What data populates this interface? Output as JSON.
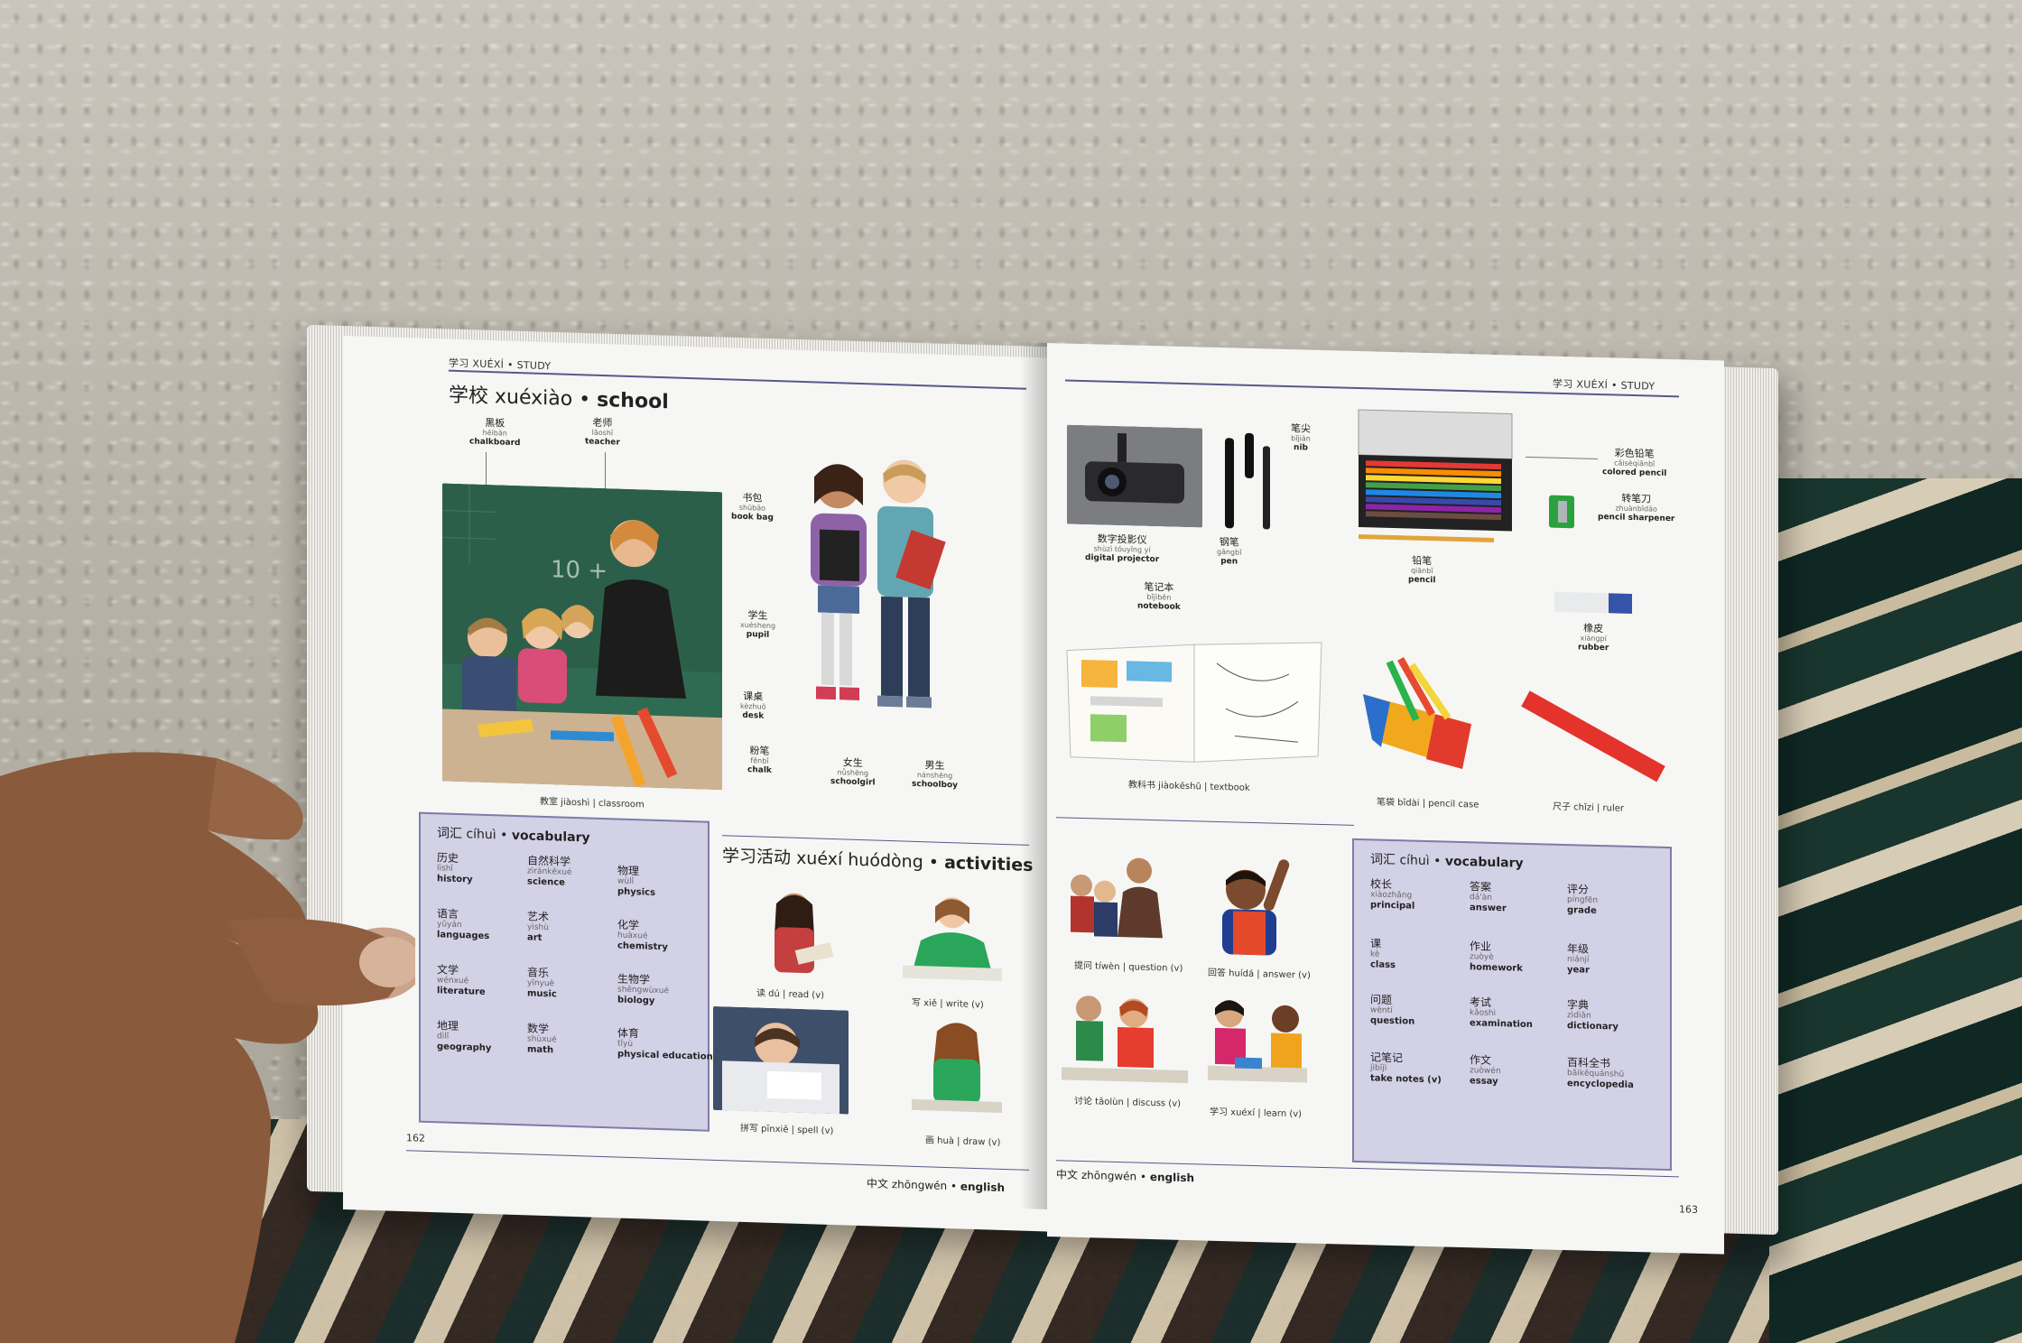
{
  "left_page": {
    "running_head": "学习 XUÉXÍ • STUDY",
    "title_zh": "学校",
    "title_py": "xuéxiào",
    "title_en": "school",
    "labels": [
      {
        "zh": "黑板",
        "py": "hēibǎn",
        "en": "chalkboard"
      },
      {
        "zh": "老师",
        "py": "lǎoshī",
        "en": "teacher"
      },
      {
        "zh": "书包",
        "py": "shūbāo",
        "en": "book bag"
      },
      {
        "zh": "学生",
        "py": "xuésheng",
        "en": "pupil"
      },
      {
        "zh": "课桌",
        "py": "kèzhuō",
        "en": "desk"
      },
      {
        "zh": "粉笔",
        "py": "fěnbǐ",
        "en": "chalk"
      },
      {
        "zh": "女生",
        "py": "nǚshēng",
        "en": "schoolgirl"
      },
      {
        "zh": "男生",
        "py": "nánshēng",
        "en": "schoolboy"
      }
    ],
    "classroom_caption": "教室 jiàoshì | classroom",
    "vocab_title_zh": "词汇",
    "vocab_title_py": "cíhuì",
    "vocab_title_en": "vocabulary",
    "vocab": [
      {
        "zh": "历史",
        "py": "lìshǐ",
        "en": "history"
      },
      {
        "zh": "语言",
        "py": "yǔyán",
        "en": "languages"
      },
      {
        "zh": "文学",
        "py": "wénxué",
        "en": "literature"
      },
      {
        "zh": "地理",
        "py": "dìlǐ",
        "en": "geography"
      },
      {
        "zh": "自然科学",
        "py": "zìránkēxué",
        "en": "science"
      },
      {
        "zh": "艺术",
        "py": "yìshù",
        "en": "art"
      },
      {
        "zh": "音乐",
        "py": "yīnyuè",
        "en": "music"
      },
      {
        "zh": "数学",
        "py": "shùxué",
        "en": "math"
      },
      {
        "zh": "物理",
        "py": "wùlǐ",
        "en": "physics"
      },
      {
        "zh": "化学",
        "py": "huàxué",
        "en": "chemistry"
      },
      {
        "zh": "生物学",
        "py": "shēngwùxué",
        "en": "biology"
      },
      {
        "zh": "体育",
        "py": "tǐyù",
        "en": "physical education"
      }
    ],
    "activities_title_zh": "学习活动",
    "activities_title_py": "xuéxí huódòng",
    "activities_title_en": "activities",
    "activity_captions": [
      "读 dú | read (v)",
      "写 xiě | write (v)",
      "拼写 pīnxiě | spell (v)",
      "画 huà | draw (v)"
    ],
    "page_number": "162",
    "footer_zh": "中文",
    "footer_py": "zhōngwén",
    "footer_en": "english"
  },
  "right_page": {
    "running_head": "学习 XUÉXÍ • STUDY",
    "labels": [
      {
        "zh": "笔尖",
        "py": "bǐjiān",
        "en": "nib"
      },
      {
        "zh": "彩色铅笔",
        "py": "cǎisèqiānbǐ",
        "en": "colored pencil"
      },
      {
        "zh": "转笔刀",
        "py": "zhuànbǐdāo",
        "en": "pencil sharpener"
      },
      {
        "zh": "数字投影仪",
        "py": "shùzì tóuyǐng yí",
        "en": "digital projector"
      },
      {
        "zh": "钢笔",
        "py": "gāngbǐ",
        "en": "pen"
      },
      {
        "zh": "铅笔",
        "py": "qiānbǐ",
        "en": "pencil"
      },
      {
        "zh": "笔记本",
        "py": "bǐjìběn",
        "en": "notebook"
      },
      {
        "zh": "橡皮",
        "py": "xiàngpí",
        "en": "rubber"
      }
    ],
    "item_captions": [
      "教科书 jiàokēshū | textbook",
      "笔袋 bǐdài | pencil case",
      "尺子 chǐzi | ruler"
    ],
    "activity_captions": [
      "提问 tíwèn | question (v)",
      "回答 huídá | answer (v)",
      "讨论 tǎolùn | discuss (v)",
      "学习 xuéxí | learn (v)"
    ],
    "vocab_title_zh": "词汇",
    "vocab_title_py": "cíhuì",
    "vocab_title_en": "vocabulary",
    "vocab": [
      {
        "zh": "校长",
        "py": "xiàozhǎng",
        "en": "principal"
      },
      {
        "zh": "课",
        "py": "kè",
        "en": "class"
      },
      {
        "zh": "问题",
        "py": "wèntí",
        "en": "question"
      },
      {
        "zh": "记笔记",
        "py": "jìbǐjì",
        "en": "take notes (v)"
      },
      {
        "zh": "答案",
        "py": "dá'àn",
        "en": "answer"
      },
      {
        "zh": "作业",
        "py": "zuòyè",
        "en": "homework"
      },
      {
        "zh": "考试",
        "py": "kǎoshì",
        "en": "examination"
      },
      {
        "zh": "作文",
        "py": "zuòwén",
        "en": "essay"
      },
      {
        "zh": "评分",
        "py": "píngfēn",
        "en": "grade"
      },
      {
        "zh": "年级",
        "py": "niánjí",
        "en": "year"
      },
      {
        "zh": "字典",
        "py": "zìdiǎn",
        "en": "dictionary"
      },
      {
        "zh": "百科全书",
        "py": "bǎikēquánshū",
        "en": "encyclopedia"
      }
    ],
    "page_number": "163",
    "footer_zh": "中文",
    "footer_py": "zhōngwén",
    "footer_en": "english"
  }
}
